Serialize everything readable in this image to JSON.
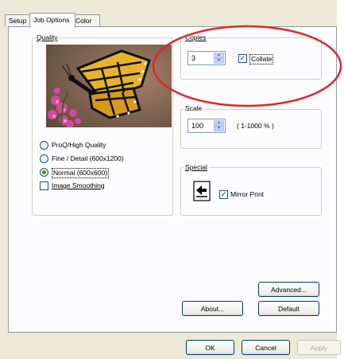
{
  "tabs": [
    {
      "label": "Setup"
    },
    {
      "label": "Job Options",
      "active": true
    },
    {
      "label": "Color"
    }
  ],
  "quality": {
    "group_label": "Quality",
    "options": [
      {
        "label": "ProQ/High Quality",
        "selected": false
      },
      {
        "label": "Fine / Detail (600x1200)",
        "selected": false
      },
      {
        "label": "Normal (600x600)",
        "selected": true
      }
    ],
    "image_smoothing": {
      "label": "Image Smoothing",
      "checked": false
    }
  },
  "copies": {
    "group_label": "Copies",
    "value": "3",
    "collate": {
      "label": "Collate",
      "checked": true
    }
  },
  "scale": {
    "group_label": "Scale",
    "value": "100",
    "range": "( 1-1000 % )"
  },
  "special": {
    "group_label": "Special",
    "mirror_print": {
      "label": "Mirror Print",
      "checked": true
    }
  },
  "buttons": {
    "advanced": "Advanced...",
    "about": "About...",
    "default": "Default",
    "ok": "OK",
    "cancel": "Cancel",
    "apply": "Apply"
  },
  "colors": {
    "highlight_ellipse": "#e0262b",
    "dialog_bg": "#ece9d8",
    "panel_bg": "#fcfcfe"
  }
}
